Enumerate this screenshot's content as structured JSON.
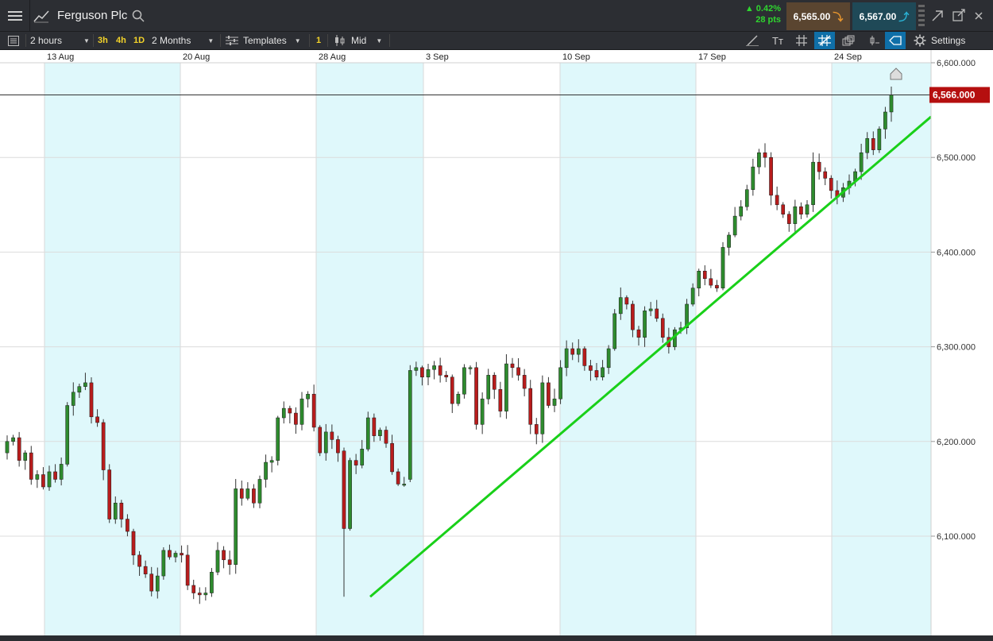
{
  "header": {
    "instrument": "Ferguson Plc",
    "change_pct": "▲ 0.42%",
    "change_pts": "28 pts",
    "sell_price": "6,565.00",
    "buy_price": "6,567.00"
  },
  "toolbar": {
    "interval": "2 hours",
    "quick_ranges": [
      "3h",
      "4h",
      "1D"
    ],
    "period": "2 Months",
    "templates_label": "Templates",
    "count_badge": "1",
    "price_type": "Mid",
    "settings_label": "Settings"
  },
  "colors": {
    "up_candle": "#2e8b2e",
    "down_candle": "#b81c1c",
    "trendline": "#19d019",
    "weekend_band": "#dff8fb",
    "current_price_bg": "#b50f0f"
  },
  "chart_data": {
    "type": "candlestick",
    "x_tick_labels": [
      "13 Aug",
      "20 Aug",
      "28 Aug",
      "3 Sep",
      "10 Sep",
      "17 Sep",
      "24 Sep"
    ],
    "y_tick_labels": [
      "6,600.000",
      "6,500.000",
      "6,400.000",
      "6,300.000",
      "6,200.000",
      "6,100.000"
    ],
    "ylim": [
      6027,
      6605
    ],
    "current_price": "6,566.000",
    "trendline": {
      "from": {
        "date": "29 Aug",
        "price": 6036
      },
      "to": {
        "date": "28 Sep",
        "price": 6543
      }
    },
    "closes": [
      6200,
      6204,
      6180,
      6188,
      6160,
      6165,
      6152,
      6168,
      6160,
      6176,
      6238,
      6252,
      6258,
      6262,
      6226,
      6220,
      6170,
      6118,
      6135,
      6118,
      6105,
      6080,
      6068,
      6060,
      6042,
      6058,
      6085,
      6078,
      6082,
      6080,
      6048,
      6040,
      6038,
      6040,
      6062,
      6085,
      6075,
      6070,
      6150,
      6140,
      6150,
      6135,
      6160,
      6178,
      6180,
      6225,
      6235,
      6230,
      6218,
      6245,
      6250,
      6215,
      6188,
      6210,
      6202,
      6188,
      6108,
      6180,
      6175,
      6192,
      6225,
      6206,
      6212,
      6198,
      6168,
      6155,
      6155,
      6275,
      6278,
      6268,
      6276,
      6280,
      6270,
      6268,
      6240,
      6250,
      6278,
      6278,
      6218,
      6245,
      6270,
      6255,
      6232,
      6282,
      6278,
      6270,
      6256,
      6218,
      6208,
      6262,
      6238,
      6245,
      6278,
      6298,
      6292,
      6298,
      6280,
      6275,
      6268,
      6278,
      6298,
      6335,
      6352,
      6345,
      6318,
      6310,
      6338,
      6340,
      6330,
      6310,
      6300,
      6318,
      6320,
      6345,
      6362,
      6380,
      6372,
      6365,
      6362,
      6405,
      6418,
      6438,
      6448,
      6466,
      6490,
      6505,
      6500,
      6460,
      6450,
      6440,
      6430,
      6448,
      6440,
      6450,
      6495,
      6485,
      6478,
      6465,
      6458,
      6468,
      6475,
      6485,
      6505,
      6520,
      6508,
      6530,
      6548,
      6566
    ]
  }
}
